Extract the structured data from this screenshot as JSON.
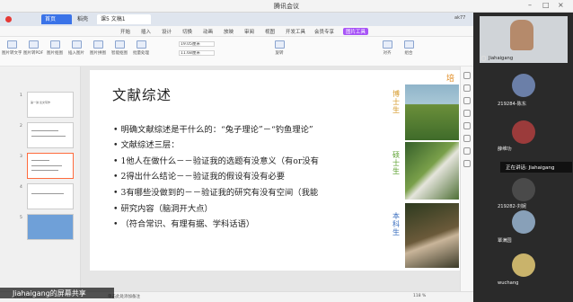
{
  "window": {
    "title": "腾讯会议"
  },
  "wps": {
    "tabs": {
      "home": "首页",
      "t2": "稻壳",
      "t3": "课5 文稿1"
    },
    "menus": [
      "开始",
      "插入",
      "设计",
      "切换",
      "动画",
      "放映",
      "审阅",
      "视图",
      "开发工具",
      "会员专享",
      "图片工具"
    ],
    "active_menu": "图片工具",
    "tools": [
      "图片转文字",
      "图片转PDF",
      "图片抠图",
      "插入图片",
      "图片拼图",
      "智能抠图",
      "批量处理",
      "旋转",
      "对齐",
      "组合"
    ],
    "fields": {
      "height": "19.05厘米",
      "width": "11.68厘米"
    },
    "thumb_labels": [
      "第一讲 论文写作",
      "2",
      "3",
      "4",
      "5"
    ],
    "thumb_numbers": [
      "1",
      "2",
      "3",
      "4",
      "5"
    ],
    "right_toolbar_icons": [
      "style-icon",
      "shape-icon",
      "select-icon",
      "text-icon",
      "cursor-icon",
      "image-icon",
      "gear-icon",
      "animate-icon"
    ],
    "status": {
      "left": "幻灯片 3/5",
      "notes": "单击此处添加备注",
      "zoom": "118 %"
    },
    "user_badge": "ak77"
  },
  "slide": {
    "title": "文献综述",
    "bullets": [
      "• 明确文献综述是干什么的：“兔子理论”－“钓鱼理论”",
      "• 文献综述三层：",
      "•          1他人在做什么－－验证我的选题有没意义（有or没有",
      "•          2得出什么结论－－验证我的假设有没有必要",
      "•          3有哪些没做到的－－验证我的研究有没有空间（我能",
      "• 研究内容（脑洞开大点）",
      "•          （符合常识、有理有据、学科话语）"
    ],
    "side_labels": {
      "top": "培",
      "bo": "博士生",
      "shuo": "硕士生",
      "ben": "本科生"
    }
  },
  "participants": [
    {
      "name": "Jiahaigang",
      "color": "#c9a27e"
    },
    {
      "name": "219284-陈东",
      "color": "#6b7fa8"
    },
    {
      "name": "薛维功",
      "color": "#9b3b3b"
    },
    {
      "name": "219282-刘妮",
      "color": "#4a4a4a"
    },
    {
      "name": "覃满园",
      "color": "#88a0b8"
    },
    {
      "name": "wuchang",
      "color": "#c9b36b"
    }
  ],
  "speaking": "正在讲话: Jiahaigang",
  "screen_share": "Jiahaigang的屏幕共享"
}
